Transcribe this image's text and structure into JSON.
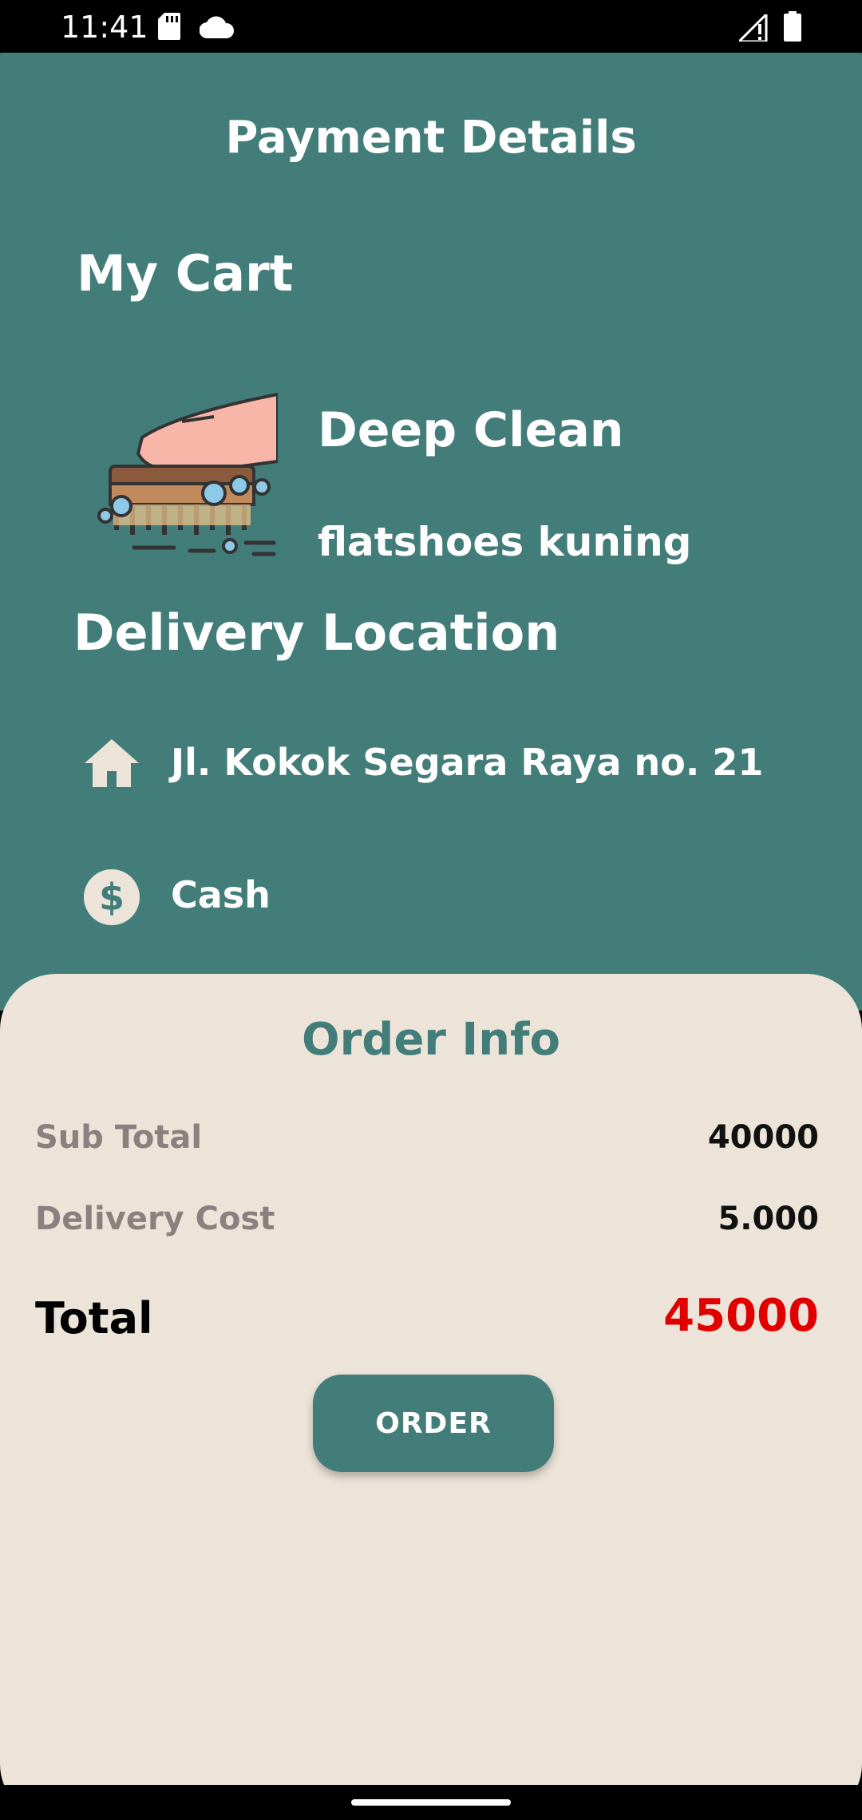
{
  "status_bar": {
    "time": "11:41",
    "icons": [
      "sd-card-icon",
      "cloud-icon",
      "signal-icon",
      "battery-icon"
    ]
  },
  "header": {
    "title": "Payment Details"
  },
  "cart": {
    "title": "My Cart",
    "item": {
      "name": "Deep Clean",
      "description": "flatshoes kuning",
      "icon": "cleaning-brush-icon"
    }
  },
  "delivery": {
    "title": "Delivery Location",
    "address": "Jl. Kokok Segara Raya no. 21",
    "address_icon": "home-icon",
    "payment_method": "Cash",
    "payment_icon": "dollar-icon"
  },
  "order_info": {
    "title": "Order Info",
    "subtotal_label": "Sub Total",
    "subtotal_value": "40000",
    "delivery_label": "Delivery Cost",
    "delivery_value": "5.000",
    "total_label": "Total",
    "total_value": "45000",
    "order_button": "ORDER"
  },
  "colors": {
    "primary": "#437d79",
    "sheet": "#ece4d9",
    "total": "#e00000",
    "muted": "#8a8080"
  }
}
